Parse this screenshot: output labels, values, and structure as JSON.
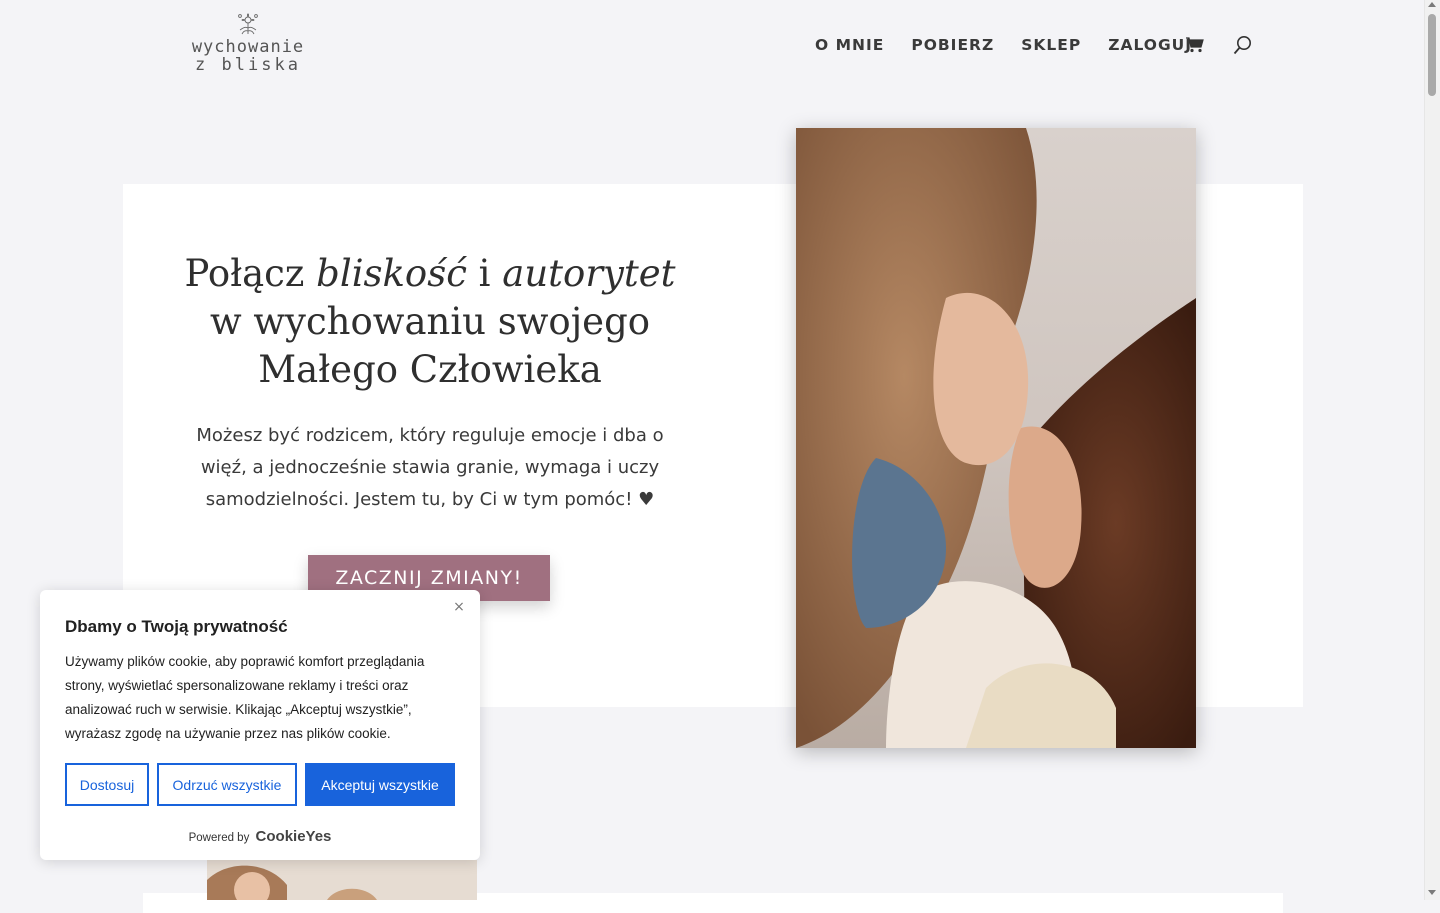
{
  "header": {
    "logo": {
      "line1": "wychowanie",
      "line2": "z bliska"
    },
    "nav": [
      "O MNIE",
      "POBIERZ",
      "SKLEP",
      "ZALOGUJ"
    ],
    "cart_icon": "cart-icon",
    "search_icon": "search-icon"
  },
  "hero": {
    "title_1": "Połącz ",
    "title_em1": "bliskość",
    "title_2": " i ",
    "title_em2": "autorytet",
    "title_3": "w wychowaniu swojego",
    "title_4": "Małego Człowieka",
    "text": "Możesz być rodzicem, który reguluje emocje i dba o więź, a jednocześnie stawia granie, wymaga i uczy samodzielności. Jestem tu, by Ci w tym pomóc! ♥",
    "cta": "ZACZNIJ ZMIANY!"
  },
  "cookie": {
    "title": "Dbamy o Twoją prywatność",
    "text": "Używamy plików cookie, aby poprawić komfort przeglądania strony, wyświetlać spersonalizowane reklamy i treści oraz analizować ruch w serwisie. Klikając „Akceptuj wszystkie”, wyrażasz zgodę na używanie przez nas plików cookie.",
    "customize": "Dostosuj",
    "reject": "Odrzuć wszystkie",
    "accept": "Akceptuj wszystkie",
    "powered_by": "Powered by",
    "brand": "CookieYes",
    "close": "×"
  },
  "colors": {
    "background": "#f4f4f7",
    "cta": "#a07080",
    "cookie_accent": "#1863dc"
  }
}
